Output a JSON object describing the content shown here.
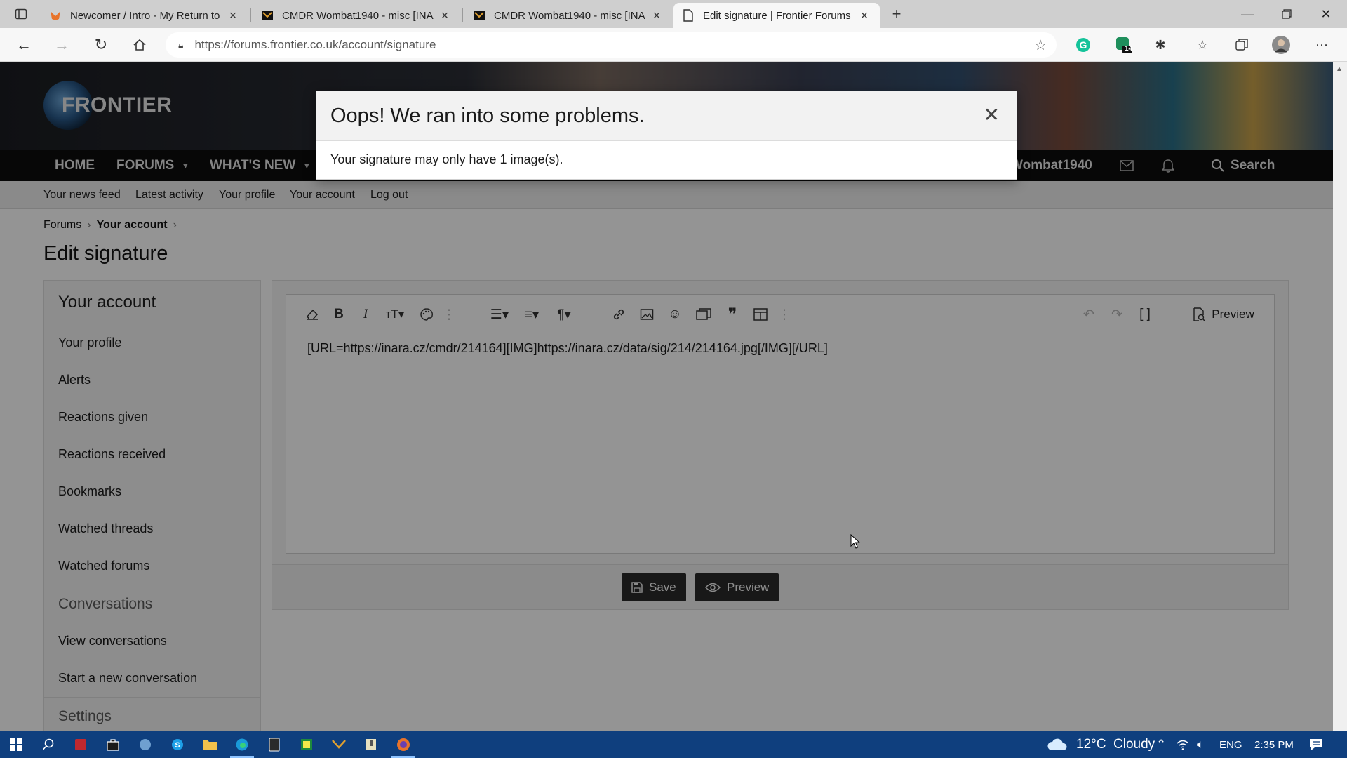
{
  "browser": {
    "tabs": [
      {
        "title": "Newcomer / Intro - My Return to",
        "icon": "firefox-fox-icon",
        "active": false
      },
      {
        "title": "CMDR Wombat1940 - misc [INA",
        "icon": "inara-icon",
        "active": false
      },
      {
        "title": "CMDR Wombat1940 - misc [INA",
        "icon": "inara-icon",
        "active": false
      },
      {
        "title": "Edit signature | Frontier Forums",
        "icon": "page-icon",
        "active": true
      }
    ],
    "url": "https://forums.frontier.co.uk/account/signature",
    "extension_badge": "14"
  },
  "site": {
    "logo_text": "FRONTIER",
    "nav": {
      "home": "HOME",
      "forums": "FORUMS",
      "whats_new": "WHAT'S NEW",
      "user": "Wombat1940",
      "search": "Search"
    },
    "subnav": [
      "Your news feed",
      "Latest activity",
      "Your profile",
      "Your account",
      "Log out"
    ],
    "breadcrumb": {
      "root": "Forums",
      "current": "Your account",
      "sep": "›"
    },
    "page_title": "Edit signature"
  },
  "sidebar": {
    "heading": "Your account",
    "items": [
      "Your profile",
      "Alerts",
      "Reactions given",
      "Reactions received",
      "Bookmarks",
      "Watched threads",
      "Watched forums"
    ],
    "conversations_heading": "Conversations",
    "conversation_items": [
      "View conversations",
      "Start a new conversation"
    ],
    "settings_heading": "Settings"
  },
  "editor": {
    "content": "[URL=https://inara.cz/cmdr/214164][IMG]https://inara.cz/data/sig/214/214164.jpg[/IMG][/URL]",
    "preview_tab": "Preview",
    "save_label": "Save",
    "preview_label": "Preview"
  },
  "dialog": {
    "title": "Oops! We ran into some problems.",
    "message": "Your signature may only have 1 image(s).",
    "close": "✕"
  },
  "taskbar": {
    "weather": "12°C  Cloudy",
    "lang": "ENG",
    "time": "2:35 PM"
  },
  "colors": {
    "site_nav_bg": "#0d0d0d",
    "taskbar_bg": "#0f3f7e",
    "button_bg": "#2a2a2a"
  }
}
